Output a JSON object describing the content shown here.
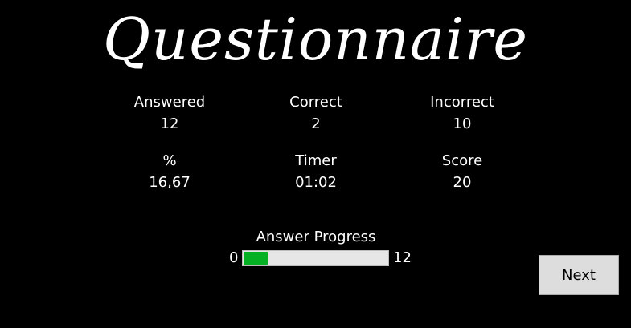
{
  "window": {
    "title": "Questionnaire"
  },
  "stats": {
    "answered": {
      "label": "Answered",
      "value": "12"
    },
    "correct": {
      "label": "Correct",
      "value": "2"
    },
    "incorrect": {
      "label": "Incorrect",
      "value": "10"
    },
    "percent": {
      "label": "%",
      "value": "16,67"
    },
    "timer": {
      "label": "Timer",
      "value": "01:02"
    },
    "score": {
      "label": "Score",
      "value": "20"
    }
  },
  "progress": {
    "label": "Answer Progress",
    "min": "0",
    "max": "12",
    "fraction": 0.17,
    "fill_color": "#06b025",
    "track_color": "#e6e6e6"
  },
  "buttons": {
    "next_label": "Next"
  }
}
